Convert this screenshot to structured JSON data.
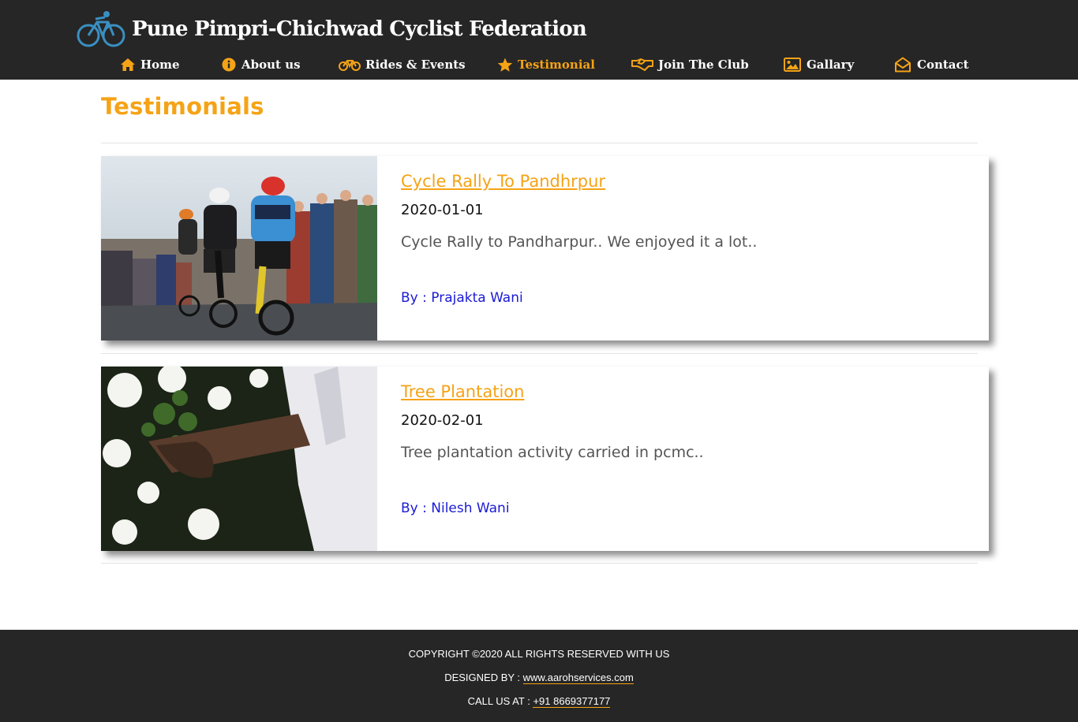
{
  "site": {
    "title": "Pune Pimpri-Chichwad Cyclist Federation",
    "logo_icon": "bicycle-logo-icon"
  },
  "nav": {
    "items": [
      {
        "label": "Home",
        "icon": "home-icon"
      },
      {
        "label": "About us",
        "icon": "info-icon"
      },
      {
        "label": "Rides & Events",
        "icon": "bicycle-icon"
      },
      {
        "label": "Testimonial",
        "icon": "star-icon",
        "active": true
      },
      {
        "label": "Join The Club",
        "icon": "handshake-icon"
      },
      {
        "label": "Gallary",
        "icon": "image-icon"
      },
      {
        "label": "Contact",
        "icon": "envelope-open-icon"
      }
    ]
  },
  "main": {
    "title": "Testimonials",
    "cards": [
      {
        "title": "Cycle Rally To Pandhrpur",
        "date": "2020-01-01",
        "description": "Cycle Rally to Pandharpur.. We enjoyed it a lot..",
        "author": "By : Prajakta Wani",
        "image": "cyclists-racing-photo"
      },
      {
        "title": "Tree Plantation",
        "date": "2020-02-01",
        "description": "Tree plantation activity carried in pcmc..",
        "author": "By : Nilesh Wani",
        "image": "hands-holding-plant-photo"
      }
    ]
  },
  "footer": {
    "copyright": "COPYRIGHT ©2020 ALL RIGHTS RESERVED WITH US",
    "designed_by_label": "DESIGNED BY :",
    "designed_by_link": "www.aarohservices.com",
    "call_label": "CALL US AT :",
    "call_number": "+91 8669377177"
  },
  "colors": {
    "accent": "#f5a316",
    "header_bg": "#262626",
    "author": "#1a1ad6"
  }
}
